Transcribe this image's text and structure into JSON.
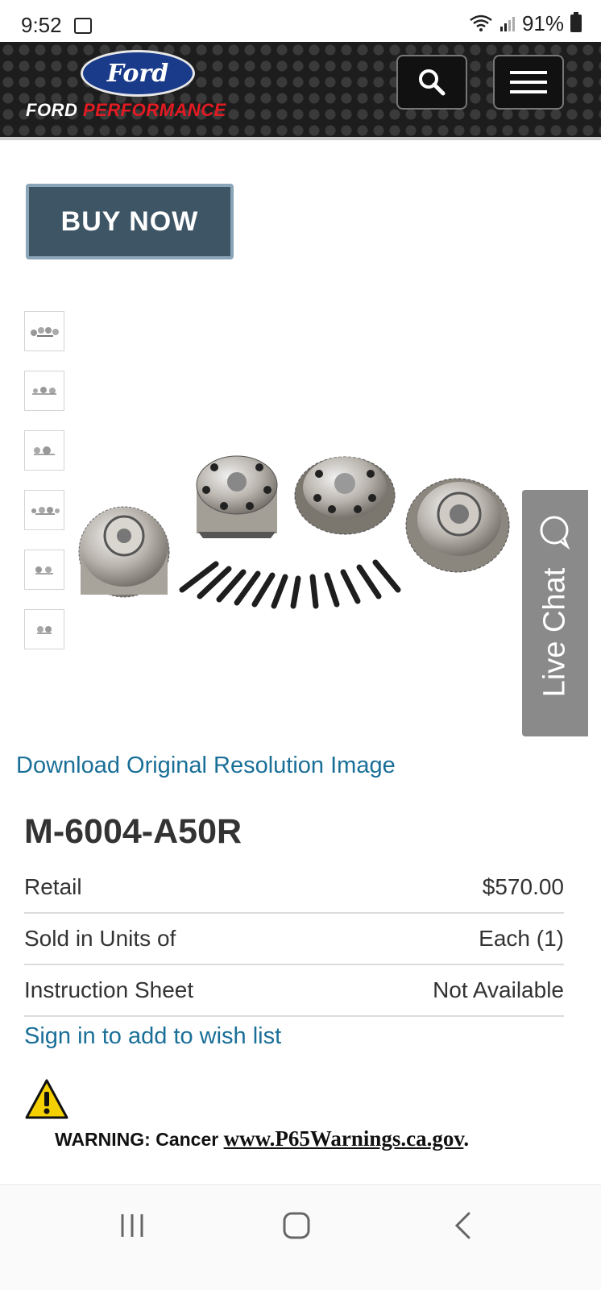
{
  "status_bar": {
    "time": "9:52",
    "battery": "91%"
  },
  "header": {
    "logo_text": "Ford",
    "brand_ford": "FORD",
    "brand_performance": "PERFORMANCE",
    "icons": [
      "search-icon",
      "menu-icon"
    ]
  },
  "buy_button": {
    "label": "BUY NOW"
  },
  "gallery": {
    "thumbnail_count": 6
  },
  "live_chat": {
    "label": "Live Chat"
  },
  "download_link": "Download Original Resolution Image",
  "product": {
    "part_number": "M-6004-A50R",
    "specs": [
      {
        "label": "Retail",
        "value": "$570.00"
      },
      {
        "label": "Sold in Units of",
        "value": "Each (1)"
      },
      {
        "label": "Instruction Sheet",
        "value": "Not Available"
      }
    ]
  },
  "wishlist_link": "Sign in to add to wish list",
  "warning": {
    "label": "WARNING: Cancer ",
    "url": "www.P65Warnings.ca.gov",
    "suffix": "."
  },
  "colors": {
    "accent_link": "#1a6f98",
    "buy_button": "#3e5566",
    "header_bg": "#1d1d1d",
    "performance_red": "#e21b23",
    "live_chat_bg": "#8a8a8a"
  }
}
